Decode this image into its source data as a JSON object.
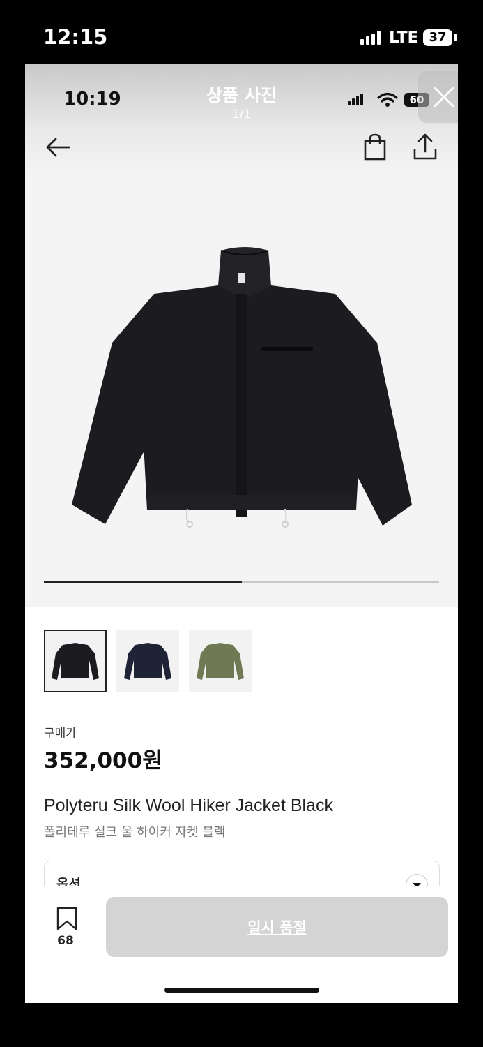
{
  "status_bar": {
    "time": "12:15",
    "network": "LTE",
    "battery": "37"
  },
  "inner_status_bar": {
    "time": "10:19",
    "battery": "60"
  },
  "viewer": {
    "title": "상품 사진",
    "counter": "1/1"
  },
  "icons": {
    "close": "close-icon",
    "back": "arrow-left-icon",
    "bag": "shopping-bag-icon",
    "share": "share-icon",
    "bookmark": "bookmark-icon",
    "chevron": "chevron-down-icon"
  },
  "gallery": {
    "progress": 0.5,
    "thumbnails": [
      {
        "color": "#1c1c20",
        "selected": true
      },
      {
        "color": "#1e2436",
        "selected": false
      },
      {
        "color": "#6f7a55",
        "selected": false
      }
    ]
  },
  "product": {
    "price_label": "구매가",
    "price": "352,000원",
    "name_en": "Polyteru Silk Wool Hiker Jacket Black",
    "name_ko": "폴리테루 실크 울 하이커 자켓 블랙"
  },
  "option": {
    "label": "옵션"
  },
  "bottom_bar": {
    "bookmark_count": "68",
    "soldout_label": "일시 품절"
  },
  "colors": {
    "jacket_black": "#1c1c20",
    "soldout_bg": "#d4d4d4"
  }
}
